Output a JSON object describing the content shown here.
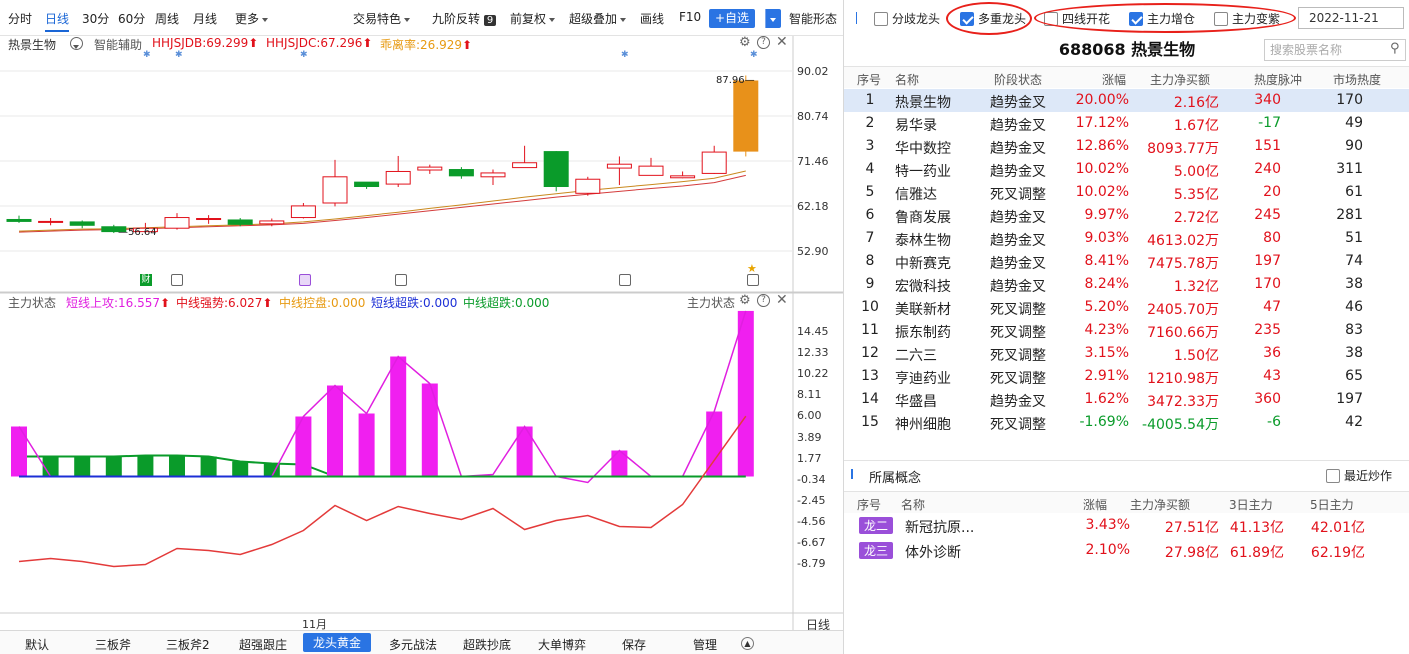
{
  "toolbar": {
    "tabs": [
      "分时",
      "日线",
      "30分",
      "60分",
      "周线",
      "月线",
      "更多"
    ],
    "active": "日线",
    "items": [
      "交易特色",
      "九阶反转",
      "前复权",
      "超级叠加",
      "画线",
      "F10"
    ],
    "nine_badge": "9",
    "add_label": "+自选",
    "smart": "智能形态"
  },
  "kchart": {
    "stock": "热景生物",
    "assist": "智能辅助",
    "indicators": [
      {
        "label": "HHJSJDB:69.299",
        "color": "#e1111b"
      },
      {
        "label": "HHJSJDC:67.296",
        "color": "#e1111b"
      },
      {
        "label": "乖离率:26.929",
        "color": "#e79a12"
      }
    ],
    "yticks": [
      "90.02",
      "80.74",
      "71.46",
      "62.18",
      "52.90"
    ],
    "high_label": "87.96",
    "low_label": "56.64",
    "marker_labels": [
      "财"
    ],
    "candles": [
      [
        59.4,
        59.0,
        60.2,
        58.7
      ],
      [
        58.9,
        59.0,
        59.7,
        58.2
      ],
      [
        58.9,
        58.2,
        59.2,
        57.6
      ],
      [
        57.9,
        56.9,
        58.3,
        56.6
      ],
      [
        56.9,
        57.6,
        58.7,
        56.6
      ],
      [
        57.6,
        59.8,
        60.7,
        57.3
      ],
      [
        59.4,
        59.6,
        60.3,
        58.5
      ],
      [
        59.3,
        58.4,
        59.7,
        58.0
      ],
      [
        58.5,
        59.1,
        59.6,
        58.0
      ],
      [
        59.8,
        62.2,
        62.8,
        59.6
      ],
      [
        62.8,
        68.2,
        71.7,
        62.1
      ],
      [
        67.1,
        66.2,
        67.1,
        65.7
      ],
      [
        66.7,
        69.3,
        72.5,
        66.1
      ],
      [
        69.6,
        70.2,
        70.7,
        68.8
      ],
      [
        69.7,
        68.4,
        70.2,
        67.8
      ],
      [
        68.2,
        69.0,
        69.7,
        66.5
      ],
      [
        70.1,
        71.1,
        74.6,
        70.1
      ],
      [
        73.4,
        66.2,
        73.5,
        65.2
      ],
      [
        64.8,
        67.7,
        68.2,
        64.3
      ],
      [
        70.0,
        70.8,
        72.4,
        66.5
      ],
      [
        68.5,
        70.4,
        72.1,
        68.5
      ],
      [
        68.0,
        68.4,
        69.3,
        67.9
      ],
      [
        68.9,
        73.3,
        74.6,
        68.8
      ],
      [
        73.5,
        87.96,
        89.1,
        72.4
      ]
    ],
    "ma1": [
      56.8,
      57.0,
      57.2,
      57.3,
      57.5,
      57.7,
      57.9,
      58.1,
      58.3,
      58.6,
      59.2,
      59.8,
      60.5,
      61.2,
      61.9,
      62.6,
      63.3,
      64.0,
      64.6,
      65.2,
      65.8,
      66.3,
      67.0,
      68.5
    ],
    "ma2": [
      57.0,
      57.2,
      57.4,
      57.5,
      57.7,
      57.9,
      58.1,
      58.3,
      58.5,
      58.9,
      59.5,
      60.2,
      60.9,
      61.7,
      62.4,
      63.2,
      64.0,
      64.7,
      65.4,
      66.0,
      66.6,
      67.2,
      67.9,
      69.4
    ]
  },
  "ichart": {
    "name": "主力状态",
    "right_name": "主力状态",
    "legend": [
      {
        "label": "短线上攻:16.557",
        "color": "#e01fe0",
        "arrow": "#e1111b"
      },
      {
        "label": "中线强势:6.027",
        "color": "#e1111b",
        "arrow": "#e1111b"
      },
      {
        "label": "中线控盘:0.000",
        "color": "#e79a12"
      },
      {
        "label": "短线超跌:0.000",
        "color": "#1c2fd6"
      },
      {
        "label": "中线超跌:0.000",
        "color": "#0a9b2a"
      }
    ],
    "yticks": [
      "14.45",
      "12.33",
      "10.22",
      "8.11",
      "6.00",
      "3.89",
      "1.77",
      "-0.34",
      "-2.45",
      "-4.56",
      "-6.67",
      "-8.79"
    ],
    "magenta": [
      5.0,
      0,
      0,
      0,
      0,
      0,
      0,
      0,
      0,
      6.0,
      9.1,
      6.3,
      12.0,
      9.3,
      0,
      0.2,
      5.0,
      0,
      -0.6,
      2.6,
      0,
      0,
      6.5,
      16.557
    ],
    "green": [
      2.0,
      2.0,
      2.0,
      2.0,
      2.1,
      2.1,
      2.0,
      1.5,
      1.3,
      1.2
    ],
    "red": [
      -8.5,
      -8.2,
      -8.5,
      -9.0,
      -8.8,
      -7.2,
      -7.4,
      -7.8,
      -6.8,
      -5.4,
      -2.9,
      -4.4,
      -3.0,
      -3.7,
      -4.3,
      -3.2,
      -5.3,
      -4.4,
      -3.9,
      -5.0,
      -5.1,
      -2.8,
      6.027
    ],
    "xlabel": "11月",
    "period": "日线"
  },
  "bottom_tabs": [
    "默认",
    "三板斧",
    "三板斧2",
    "超强跟庄",
    "龙头黄金",
    "多元战法",
    "超跌抄底",
    "大单博弈",
    "保存",
    "管理"
  ],
  "bottom_active": "龙头黄金",
  "filters": [
    {
      "label": "分歧龙头",
      "checked": false
    },
    {
      "label": "多重龙头",
      "checked": true
    },
    {
      "label": "四线开花",
      "checked": false
    },
    {
      "label": "主力增仓",
      "checked": true
    },
    {
      "label": "主力变紫",
      "checked": false
    }
  ],
  "date": "2022-11-21",
  "stock_title": "688068  热景生物",
  "search_placeholder": "搜索股票名称",
  "table": {
    "headers": [
      "序号",
      "名称",
      "阶段状态",
      "涨幅",
      "主力净买额",
      "热度脉冲",
      "市场热度"
    ],
    "rows": [
      [
        "1",
        "热景生物",
        "趋势金叉",
        "20.00%",
        "2.16亿",
        "340",
        "170"
      ],
      [
        "2",
        "易华录",
        "趋势金叉",
        "17.12%",
        "1.67亿",
        "-17",
        "49"
      ],
      [
        "3",
        "华中数控",
        "趋势金叉",
        "12.86%",
        "8093.77万",
        "151",
        "90"
      ],
      [
        "4",
        "特一药业",
        "趋势金叉",
        "10.02%",
        "5.00亿",
        "240",
        "311"
      ],
      [
        "5",
        "信雅达",
        "死叉调整",
        "10.02%",
        "5.35亿",
        "20",
        "61"
      ],
      [
        "6",
        "鲁商发展",
        "趋势金叉",
        "9.97%",
        "2.72亿",
        "245",
        "281"
      ],
      [
        "7",
        "泰林生物",
        "趋势金叉",
        "9.03%",
        "4613.02万",
        "80",
        "51"
      ],
      [
        "8",
        "中新赛克",
        "趋势金叉",
        "8.41%",
        "7475.78万",
        "197",
        "74"
      ],
      [
        "9",
        "宏微科技",
        "趋势金叉",
        "8.24%",
        "1.32亿",
        "170",
        "38"
      ],
      [
        "10",
        "美联新材",
        "死叉调整",
        "5.20%",
        "2405.70万",
        "47",
        "46"
      ],
      [
        "11",
        "振东制药",
        "死叉调整",
        "4.23%",
        "7160.66万",
        "235",
        "83"
      ],
      [
        "12",
        "二六三",
        "死叉调整",
        "3.15%",
        "1.50亿",
        "36",
        "38"
      ],
      [
        "13",
        "亨迪药业",
        "死叉调整",
        "2.91%",
        "1210.98万",
        "43",
        "65"
      ],
      [
        "14",
        "华盛昌",
        "趋势金叉",
        "1.62%",
        "3472.33万",
        "360",
        "197"
      ],
      [
        "15",
        "神州细胞",
        "死叉调整",
        "-1.69%",
        "-4005.54万",
        "-6",
        "42"
      ]
    ]
  },
  "concepts": {
    "title": "所属概念",
    "recent": "最近炒作",
    "headers": [
      "序号",
      "名称",
      "涨幅",
      "主力净买额",
      "3日主力",
      "5日主力"
    ],
    "rows": [
      [
        "龙二",
        "新冠抗原...",
        "3.43%",
        "27.51亿",
        "41.13亿",
        "42.01亿"
      ],
      [
        "龙三",
        "体外诊断",
        "2.10%",
        "27.98亿",
        "61.89亿",
        "62.19亿"
      ]
    ]
  },
  "colors": {
    "up": "#e1111b",
    "down": "#0a9b2a",
    "accent": "#2a74e3",
    "yellow_candle": "#e8911a"
  }
}
